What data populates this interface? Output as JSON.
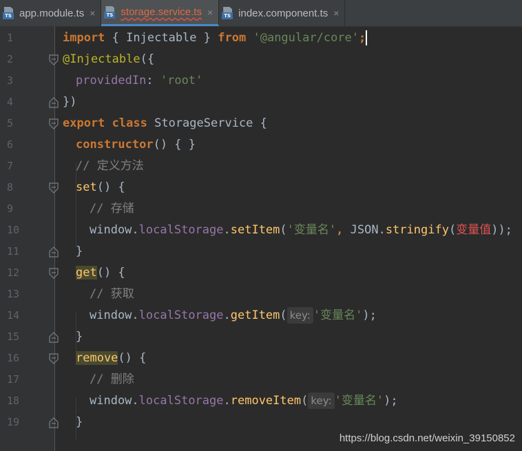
{
  "tabs": [
    {
      "label": "app.module.ts",
      "icon": "typescript-file-icon",
      "badge": "TS",
      "close": "×"
    },
    {
      "label": "storage.service.ts",
      "icon": "typescript-file-icon",
      "badge": "TS",
      "close": "×",
      "active": true
    },
    {
      "label": "index.component.ts",
      "icon": "typescript-file-icon",
      "badge": "TS",
      "close": "×"
    }
  ],
  "line_numbers": [
    "1",
    "2",
    "3",
    "4",
    "5",
    "6",
    "7",
    "8",
    "9",
    "10",
    "11",
    "12",
    "13",
    "14",
    "15",
    "16",
    "17",
    "18",
    "19"
  ],
  "code": {
    "l1": {
      "import": "import",
      "lbrace": "{",
      "injectable": "Injectable",
      "rbrace": "}",
      "from": "from",
      "module": "'@angular/core'",
      "semi": ";"
    },
    "l2": {
      "decorator": "@Injectable",
      "paren": "({"
    },
    "l3": {
      "prop": "providedIn",
      "colon": ":",
      "value": "'root'"
    },
    "l4": {
      "close": "})"
    },
    "l5": {
      "export": "export",
      "class": "class",
      "name": "StorageService",
      "brace": "{"
    },
    "l6": {
      "ctor": "constructor",
      "rest": "() { }"
    },
    "l7": {
      "comment": "// 定义方法"
    },
    "l8": {
      "name": "set",
      "rest": "() {"
    },
    "l9": {
      "comment": "// 存储"
    },
    "l10": {
      "window": "window",
      "dot1": ".",
      "storage": "localStorage",
      "dot2": ".",
      "method": "setItem",
      "open": "(",
      "key": "'变量名'",
      "comma": ", ",
      "json": "JSON",
      "dot3": ".",
      "stringify": "stringify",
      "open2": "(",
      "val": "变量值",
      "close": "));"
    },
    "l11": {
      "close": "}"
    },
    "l12": {
      "name": "get",
      "rest": "() {"
    },
    "l13": {
      "comment": "// 获取"
    },
    "l14": {
      "window": "window",
      "dot1": ".",
      "storage": "localStorage",
      "dot2": ".",
      "method": "getItem",
      "open": "(",
      "hint": "key:",
      "key": "'变量名'",
      "close": ");"
    },
    "l15": {
      "close": "}"
    },
    "l16": {
      "name": "remove",
      "rest": "() {"
    },
    "l17": {
      "comment": "// 删除"
    },
    "l18": {
      "window": "window",
      "dot1": ".",
      "storage": "localStorage",
      "dot2": ".",
      "method": "removeItem",
      "open": "(",
      "hint": "key:",
      "key": "'变量名'",
      "close": ");"
    },
    "l19": {
      "close": "}"
    }
  },
  "watermark": "https://blog.csdn.net/weixin_39150852",
  "colors": {
    "background": "#2b2b2b",
    "keyword": "#cc7832",
    "string": "#6a8759",
    "annotation": "#bbb529",
    "property": "#9876aa",
    "function": "#ffc66d",
    "comment": "#808080",
    "error": "#e05252"
  }
}
